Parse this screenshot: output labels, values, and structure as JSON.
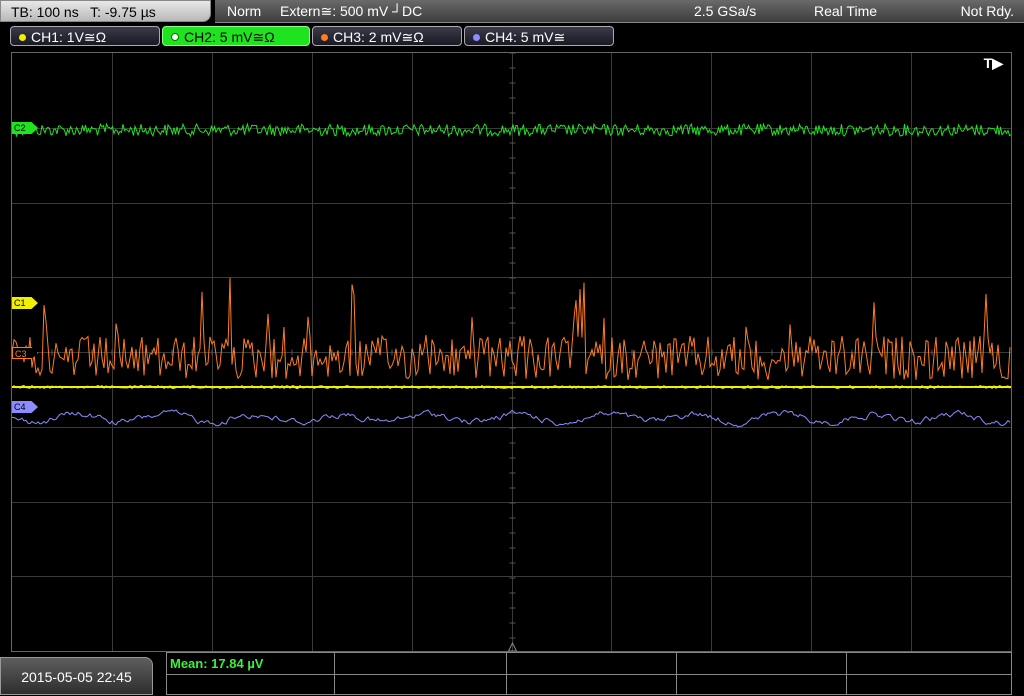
{
  "top": {
    "timebase": "TB: 100 ns   T: -9.75 µs",
    "mode": "Norm",
    "trigger": "Extern≅: 500 mV ┘DC",
    "sample_rate": "2.5 GSa/s",
    "acq_mode": "Real Time",
    "status": "Not Rdy."
  },
  "channels": [
    {
      "label": "CH1: 1V≅Ω",
      "color": "#f0f000",
      "active": false
    },
    {
      "label": "CH2: 5 mV≅Ω",
      "color": "#1ee31e",
      "active": true
    },
    {
      "label": "CH3: 2 mV≅Ω",
      "color": "#ff7d1e",
      "active": false
    },
    {
      "label": "CH4: 5 mV≅",
      "color": "#8c8cff",
      "active": false
    }
  ],
  "markers": {
    "c2": "C2",
    "c1": "C1",
    "c3": "C3",
    "c4": "C4"
  },
  "trigger_indicator": "T▶",
  "timestamp": "2015-05-05 22:45",
  "measurement": {
    "mean": "Mean: 17.84 µV"
  },
  "colors": {
    "grid": "#3a3a3a",
    "ch1": "#f0f000",
    "ch2": "#1ee31e",
    "ch3": "#ff7d1e",
    "ch4": "#8c8cff"
  }
}
